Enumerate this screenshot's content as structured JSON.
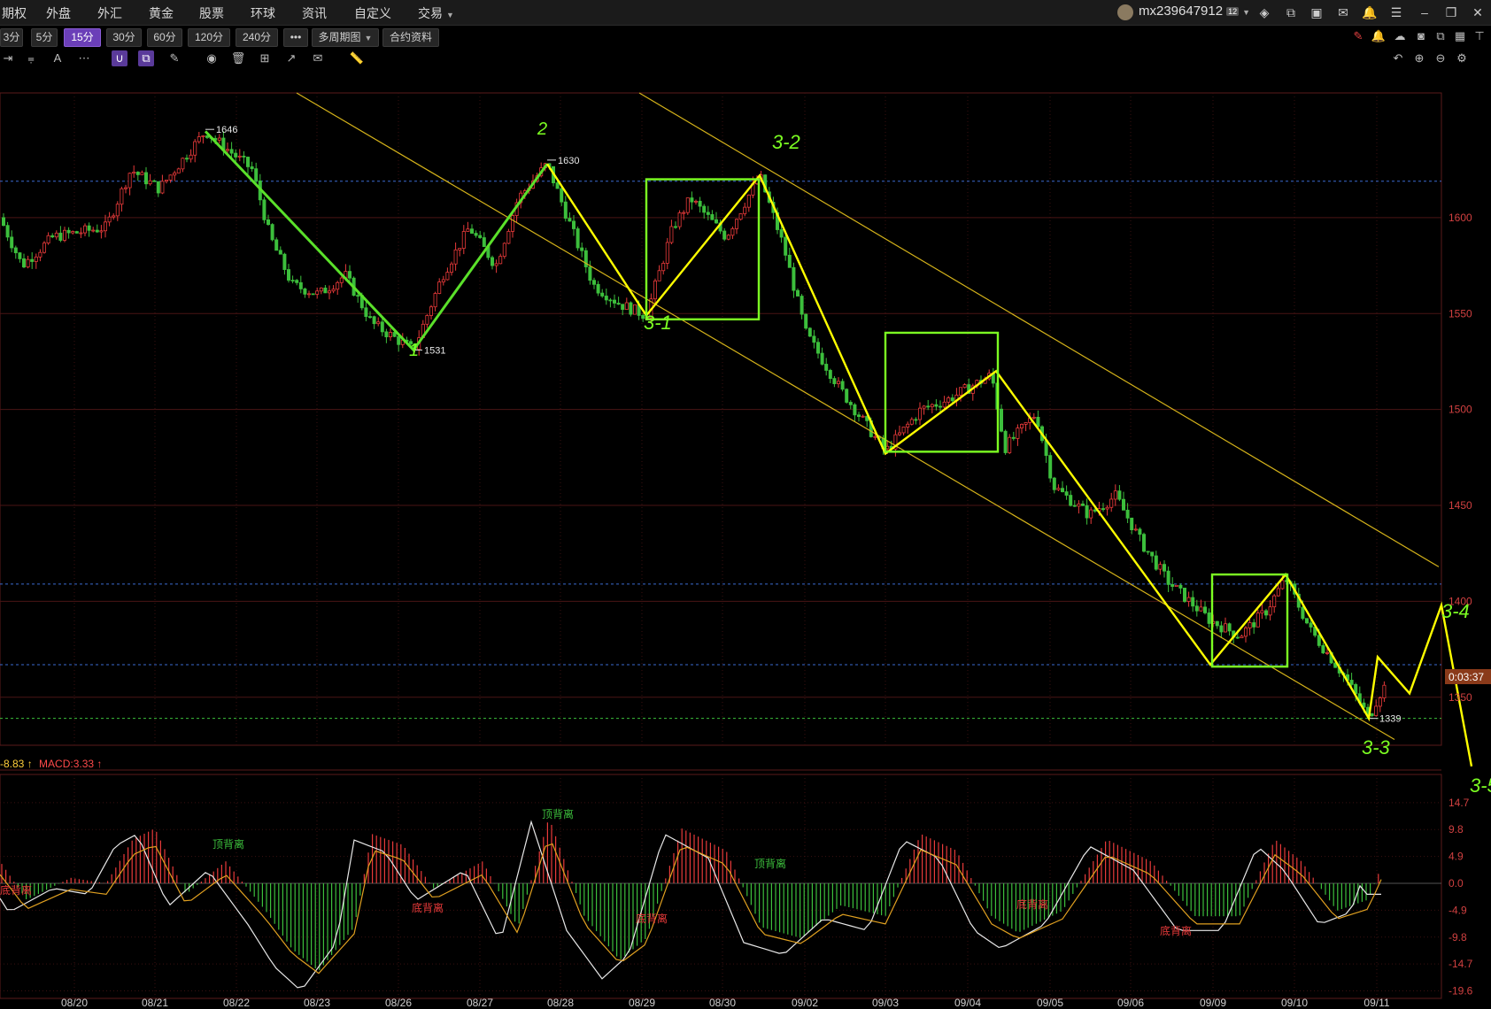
{
  "menu": {
    "items": [
      "期权",
      "外盘",
      "外汇",
      "黄金",
      "股票",
      "环球",
      "资讯",
      "自定义",
      "交易"
    ],
    "user": "mx239647912"
  },
  "periods": {
    "buttons": [
      "3分",
      "5分",
      "15分",
      "30分",
      "60分",
      "120分",
      "240分",
      "•••",
      "多周期图",
      "合约资料"
    ],
    "active": "15分"
  },
  "chart_data": {
    "type": "candlestick",
    "price_axis": {
      "ticks": [
        1600,
        1550,
        1500,
        1450,
        1400,
        1350
      ],
      "range": [
        1325,
        1665
      ]
    },
    "x_axis": {
      "labels": [
        "08/20",
        "08/21",
        "08/22",
        "08/23",
        "08/26",
        "08/27",
        "08/28",
        "08/29",
        "08/30",
        "09/02",
        "09/03",
        "09/04",
        "09/05",
        "09/06",
        "09/09",
        "09/10",
        "09/11"
      ]
    },
    "price_labels": [
      "1646",
      "1630",
      "1531",
      "1339"
    ],
    "countdown": "0:03:37",
    "wave_path": [
      {
        "date": "08/21",
        "price": 1645
      },
      {
        "date": "08/26",
        "price": 1531
      },
      {
        "date": "08/27-28",
        "price": 1628
      },
      {
        "date": "08/29",
        "price": 1549
      },
      {
        "date": "08/30",
        "price": 1622
      },
      {
        "date": "09/03",
        "price": 1476
      },
      {
        "date": "09/04",
        "price": 1520
      },
      {
        "date": "09/09",
        "price": 1367
      },
      {
        "date": "09/10",
        "price": 1414
      },
      {
        "date": "09/11",
        "price": 1339
      }
    ],
    "annotations": [
      "1",
      "2",
      "3-1",
      "3-2",
      "3-3",
      "3-4",
      "3-5"
    ],
    "macd_axis": {
      "ticks": [
        "14.7",
        "9.8",
        "4.9",
        "0.0",
        "-4.9",
        "-9.8",
        "-14.7",
        "-19.6"
      ]
    },
    "macd_labels": [
      "顶背离",
      "底背离",
      "顶背离",
      "底背离",
      "底背离",
      "顶背离",
      "底背离",
      "底背离"
    ]
  },
  "macd": {
    "dif": "-8.83",
    "macd": "MACD:3.33",
    "arrow": "↑"
  },
  "colors": {
    "up": "#e83a3a",
    "down": "#3cbf3c",
    "wave": "#ffff00",
    "ann": "#7cff22",
    "channel": "#d4b21a"
  }
}
